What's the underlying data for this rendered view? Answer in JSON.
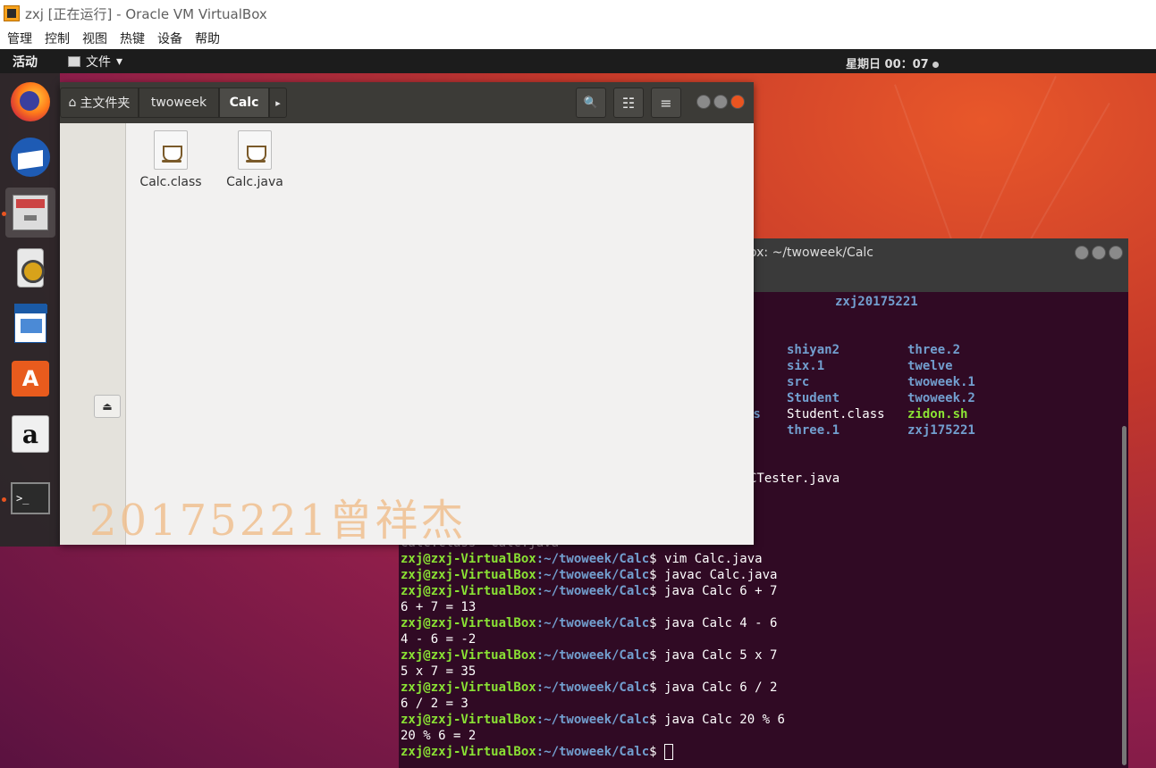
{
  "host": {
    "title": "zxj [正在运行] - Oracle VM VirtualBox",
    "menus": [
      "管理",
      "控制",
      "视图",
      "热键",
      "设备",
      "帮助"
    ]
  },
  "topbar": {
    "activities": "活动",
    "app_menu": "文件",
    "app_menu_arrow": "▾",
    "clock": "星期日 00：07"
  },
  "dock": {
    "items": [
      "firefox-icon",
      "thunderbird-icon",
      "files-icon",
      "rhythmbox-icon",
      "writer-icon",
      "software-icon",
      "amazon-icon",
      "terminal-icon"
    ],
    "amazon_glyph": "a",
    "software_glyph": "A",
    "terminal_glyph": ">_"
  },
  "files": {
    "breadcrumbs": [
      "主文件夹",
      "twoweek",
      "Calc"
    ],
    "home_glyph": "⌂",
    "more_glyph": "▸",
    "search_glyph": "🔍",
    "view_glyph": "☷",
    "menu_glyph": "≡",
    "eject_glyph": "⏏",
    "items": [
      {
        "name": "Calc.class"
      },
      {
        "name": "Calc.java"
      }
    ]
  },
  "terminal": {
    "title": "ox: ~/twoweek/Calc",
    "user_host": "zxj@zxj-VirtualBox",
    "path": ":~/twoweek/Calc",
    "listing": {
      "top": "zxj20175221",
      "col1": [
        "shiyan2",
        "six.1",
        "src",
        "Student",
        "Student.class",
        "three.1"
      ],
      "col2": [
        "three.2",
        "twelve",
        "twoweek.1",
        "twoweek.2",
        "zidon.sh",
        "zxj175221"
      ],
      "partial_ys": "ys",
      "partial_tester": "CTester.java",
      "partial_ls": "Calc.class  Calc.java"
    },
    "commands": [
      {
        "cmd": "$ vim Calc.java",
        "out": ""
      },
      {
        "cmd": "$ javac Calc.java",
        "out": ""
      },
      {
        "cmd": "$ java Calc 6 + 7",
        "out": "6 + 7 = 13"
      },
      {
        "cmd": "$ java Calc 4 - 6",
        "out": "4 - 6 = -2"
      },
      {
        "cmd": "$ java Calc 5 x 7",
        "out": "5 x 7 = 35"
      },
      {
        "cmd": "$ java Calc 6 / 2",
        "out": "6 / 2 = 3"
      },
      {
        "cmd": "$ java Calc 20 % 6",
        "out": "20 % 6 = 2"
      }
    ],
    "final_prompt": "$ "
  },
  "watermark": "20175221曾祥杰",
  "colors": {
    "prompt_user": "#8ae234",
    "prompt_path": "#729fcf",
    "terminal_bg": "#300a24",
    "accent": "#e95420"
  }
}
